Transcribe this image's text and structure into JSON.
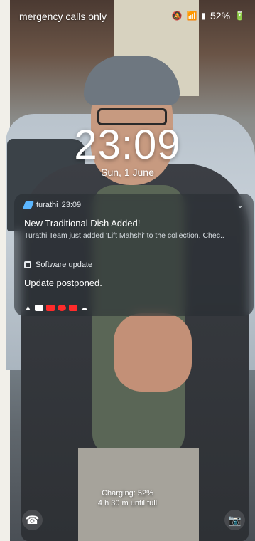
{
  "status_bar": {
    "carrier_text": "mergency calls only",
    "battery_text": "52%",
    "icons": [
      "mute-icon",
      "wifi-icon",
      "signal-icon",
      "battery-icon"
    ]
  },
  "lockscreen": {
    "time": "23:09",
    "date": "Sun, 1 June"
  },
  "notifications": {
    "turathi": {
      "app_name": "turathi",
      "time": "23:09",
      "title": "New Traditional Dish Added!",
      "body": "Turathi Team just added 'Lift Mahshi' to the collection. Chec.."
    },
    "software_update": {
      "app_name": "Software update",
      "title": "Update postponed."
    },
    "notification_icons": [
      "warning-icon",
      "gallery-icon",
      "youtube-icon",
      "record-icon",
      "youtube-icon",
      "cloud-icon"
    ]
  },
  "bottom": {
    "charging_line1": "Charging: 52%",
    "charging_line2": "4 h 30 m until full"
  },
  "colors": {
    "accent": "#5bb6ff",
    "notification_bg": "rgba(40,44,50,.58)"
  }
}
